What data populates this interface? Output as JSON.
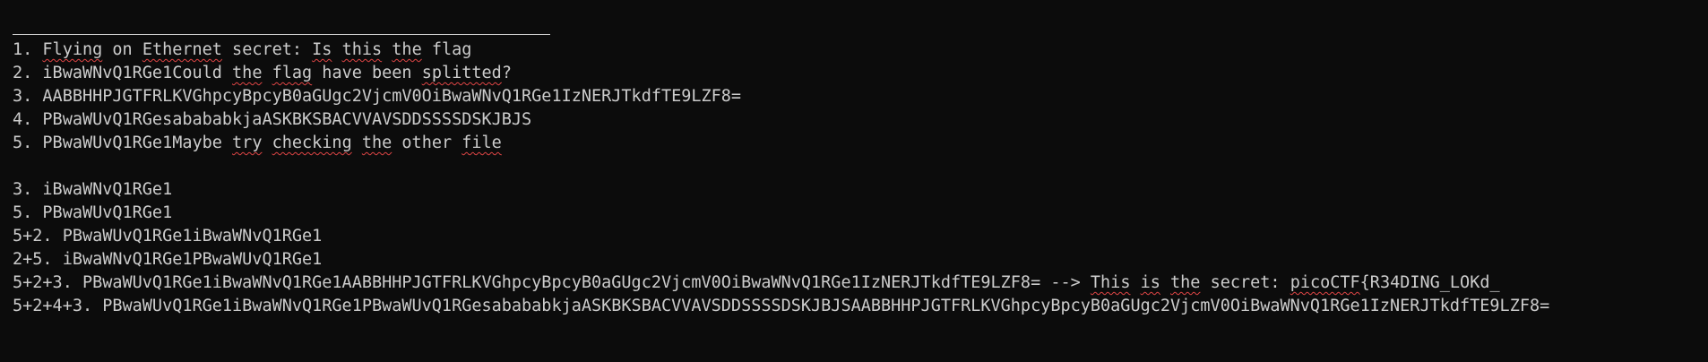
{
  "terminal": {
    "background": "#0c0c0c",
    "foreground": "#cccccc",
    "spellcheck_color": "#e04545",
    "lines": [
      {
        "segments": [
          {
            "t": "1. "
          },
          {
            "t": "Flying",
            "sq": true
          },
          {
            "t": " on "
          },
          {
            "t": "Ethernet",
            "sq": true
          },
          {
            "t": " secret: "
          },
          {
            "t": "Is",
            "sq": true
          },
          {
            "t": " "
          },
          {
            "t": "this",
            "sq": true
          },
          {
            "t": " "
          },
          {
            "t": "the",
            "sq": true
          },
          {
            "t": " flag"
          }
        ]
      },
      {
        "segments": [
          {
            "t": "2. iBwaWNvQ1RGe1Could "
          },
          {
            "t": "the",
            "sq": true
          },
          {
            "t": " "
          },
          {
            "t": "flag",
            "sq": true
          },
          {
            "t": " have been "
          },
          {
            "t": "splitted",
            "sq": true
          },
          {
            "t": "?"
          }
        ]
      },
      {
        "segments": [
          {
            "t": "3. AABBHHPJGTFRLKVGhpcyBpcyB0aGUgc2VjcmV0OiBwaWNvQ1RGe1IzNERJTkdfTE9LZF8="
          }
        ]
      },
      {
        "segments": [
          {
            "t": "4. PBwaWUvQ1RGesabababkjaASKBKSBACVVAVSDDSSSSDSKJBJS"
          }
        ]
      },
      {
        "segments": [
          {
            "t": "5. PBwaWUvQ1RGe1Maybe "
          },
          {
            "t": "try",
            "sq": true
          },
          {
            "t": " "
          },
          {
            "t": "checking",
            "sq": true
          },
          {
            "t": " "
          },
          {
            "t": "the",
            "sq": true
          },
          {
            "t": " other "
          },
          {
            "t": "file",
            "sq": true
          }
        ]
      },
      {
        "blank": true
      },
      {
        "segments": [
          {
            "t": "3. iBwaWNvQ1RGe1"
          }
        ]
      },
      {
        "segments": [
          {
            "t": "5. PBwaWUvQ1RGe1"
          }
        ]
      },
      {
        "segments": [
          {
            "t": "5+2. PBwaWUvQ1RGe1iBwaWNvQ1RGe1"
          }
        ]
      },
      {
        "segments": [
          {
            "t": "2+5. iBwaWNvQ1RGe1PBwaWUvQ1RGe1"
          }
        ]
      },
      {
        "segments": [
          {
            "t": "5+2+3. PBwaWUvQ1RGe1iBwaWNvQ1RGe1AABBHHPJGTFRLKVGhpcyBpcyB0aGUgc2VjcmV0OiBwaWNvQ1RGe1IzNERJTkdfTE9LZF8= --> "
          },
          {
            "t": "This",
            "sq": true
          },
          {
            "t": " "
          },
          {
            "t": "is",
            "sq": true
          },
          {
            "t": " "
          },
          {
            "t": "the",
            "sq": true
          },
          {
            "t": " secret: "
          },
          {
            "t": "picoCTF",
            "sq": true
          },
          {
            "t": "{R34DING_LOKd_"
          }
        ]
      },
      {
        "segments": [
          {
            "t": "5+2+4+3. PBwaWUvQ1RGe1iBwaWNvQ1RGe1PBwaWUvQ1RGesabababkjaASKBKSBACVVAVSDDSSSSDSKJBJSAABBHHPJGTFRLKVGhpcyBpcyB0aGUgc2VjcmV0OiBwaWNvQ1RGe1IzNERJTkdfTE9LZF8="
          }
        ]
      }
    ]
  }
}
